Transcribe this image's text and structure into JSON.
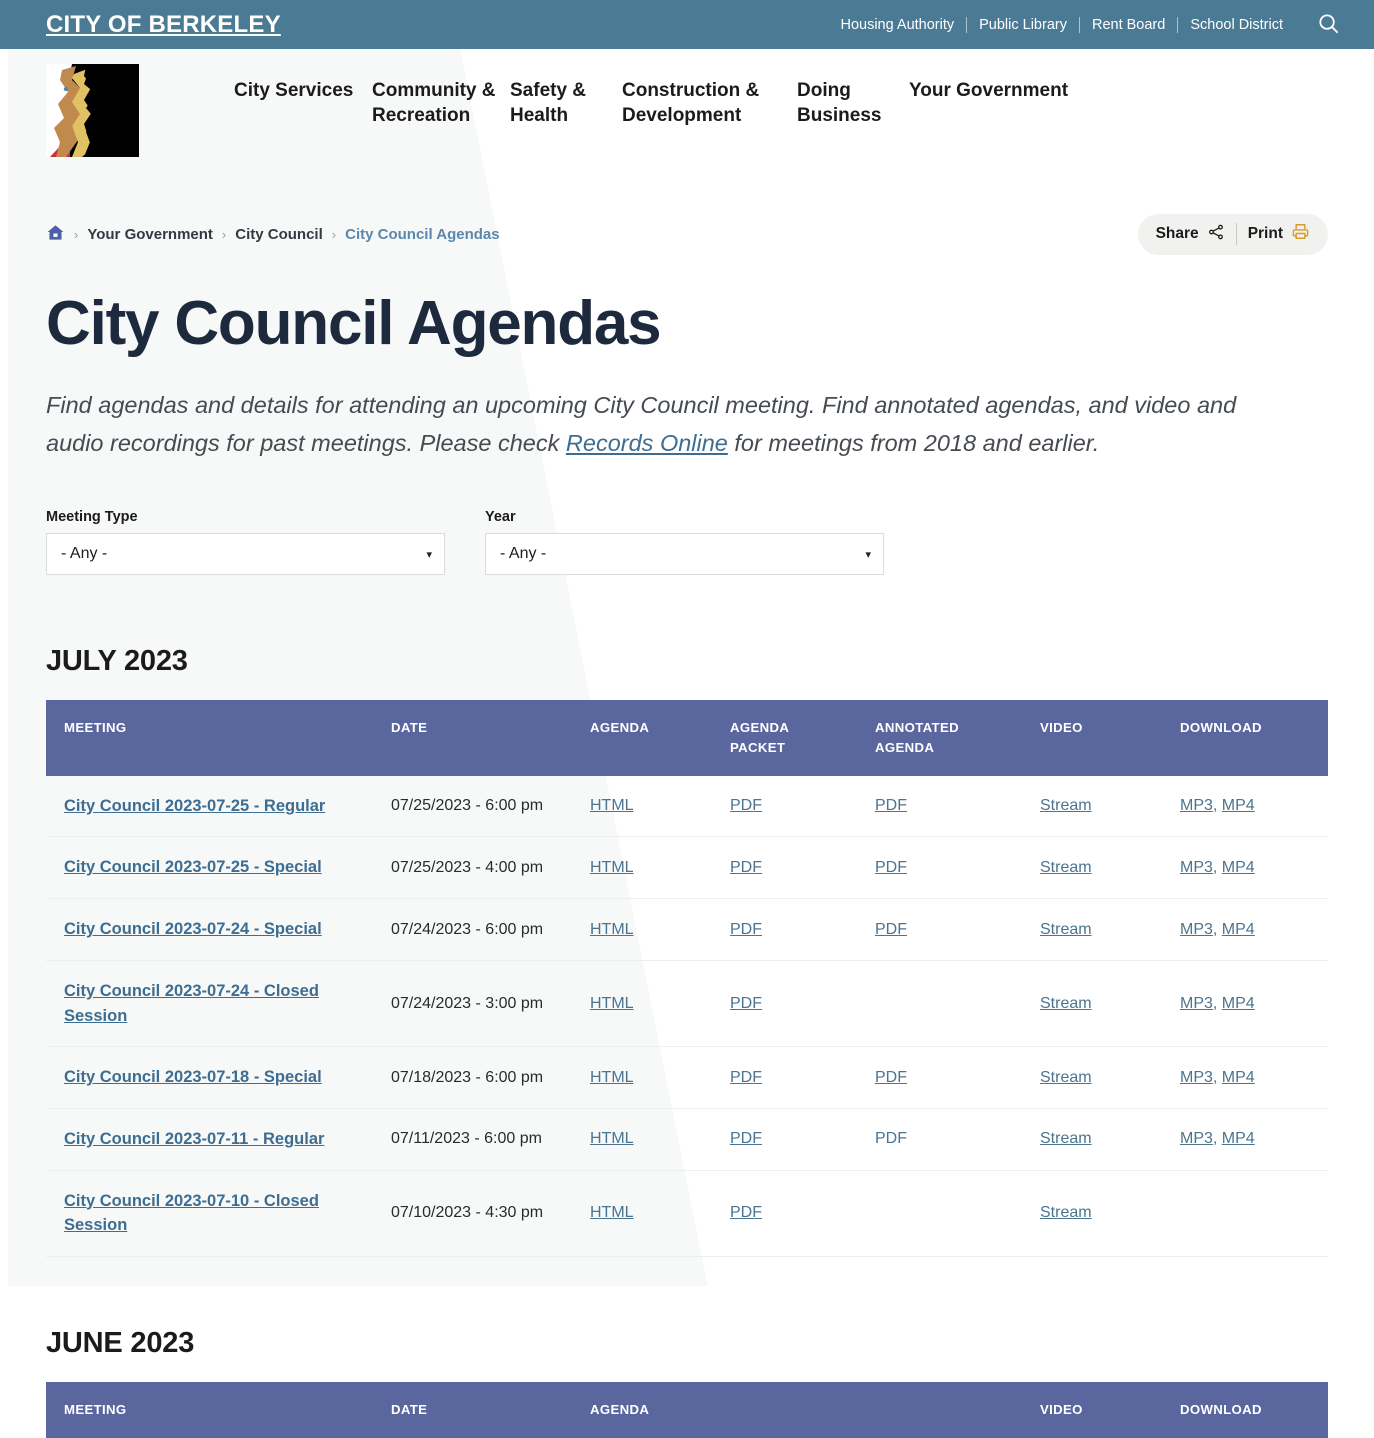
{
  "colors": {
    "utility_bar": "#4b7a94",
    "table_header": "#5a679e",
    "title": "#1d2a3d",
    "link": "#3e6d92",
    "print_icon": "#d99b2b"
  },
  "utility_bar": {
    "site_title": "CITY OF BERKELEY",
    "links": [
      "Housing Authority",
      "Public Library",
      "Rent Board",
      "School District"
    ],
    "search_icon": "search-icon"
  },
  "masthead": {
    "logo_alt": "City of Berkeley logo",
    "nav": [
      "City Services",
      "Community & Recreation",
      "Safety & Health",
      "Construction & Development",
      "Doing Business",
      "Your Government"
    ]
  },
  "breadcrumb": {
    "home_icon": "home-icon",
    "items": [
      "Your Government",
      "City Council"
    ],
    "current": "City Council Agendas",
    "separator": "›"
  },
  "actions": {
    "share_label": "Share",
    "share_icon": "share-nodes-icon",
    "print_label": "Print",
    "print_icon": "printer-icon"
  },
  "page": {
    "title": "City Council Agendas",
    "intro_part1": "Find agendas and details for attending an upcoming City Council meeting. Find annotated agendas, and video and audio recordings for past meetings. Please check ",
    "intro_link": "Records Online",
    "intro_part2": " for meetings from 2018 and earlier."
  },
  "filters": [
    {
      "label": "Meeting Type",
      "value": "- Any -",
      "caret": "▾"
    },
    {
      "label": "Year",
      "value": "- Any -",
      "caret": "▾"
    }
  ],
  "table": {
    "columns": [
      {
        "key": "meeting",
        "label": "MEETING"
      },
      {
        "key": "date",
        "label": "DATE"
      },
      {
        "key": "agenda",
        "label": "AGENDA"
      },
      {
        "key": "packet",
        "label": "AGENDA",
        "label2": "PACKET"
      },
      {
        "key": "annot",
        "label": "ANNOTATED",
        "label2": "AGENDA"
      },
      {
        "key": "video",
        "label": "VIDEO"
      },
      {
        "key": "download",
        "label": "DOWNLOAD"
      }
    ]
  },
  "sections": [
    {
      "heading": "JULY 2023",
      "rows": [
        {
          "meeting": "City Council 2023-07-25 - Regular",
          "date": "07/25/2023 - 6:00 pm",
          "agenda": "HTML",
          "packet": "PDF",
          "annot": "PDF",
          "annot_is_link": true,
          "video": "Stream",
          "download": [
            "MP3",
            "MP4"
          ]
        },
        {
          "meeting": "City Council 2023-07-25 - Special",
          "date": "07/25/2023 - 4:00 pm",
          "agenda": "HTML",
          "packet": "PDF",
          "annot": "PDF",
          "annot_is_link": true,
          "video": "Stream",
          "download": [
            "MP3",
            "MP4"
          ]
        },
        {
          "meeting": "City Council 2023-07-24 - Special",
          "date": "07/24/2023 - 6:00 pm",
          "agenda": "HTML",
          "packet": "PDF",
          "annot": "PDF",
          "annot_is_link": true,
          "video": "Stream",
          "download": [
            "MP3",
            "MP4"
          ]
        },
        {
          "meeting": "City Council 2023-07-24 - Closed Session",
          "date": "07/24/2023 - 3:00 pm",
          "agenda": "HTML",
          "packet": "PDF",
          "annot": "",
          "annot_is_link": false,
          "video": "Stream",
          "download": [
            "MP3",
            "MP4"
          ]
        },
        {
          "meeting": "City Council 2023-07-18 - Special",
          "date": "07/18/2023 - 6:00 pm",
          "agenda": "HTML",
          "packet": "PDF",
          "annot": "PDF",
          "annot_is_link": true,
          "video": "Stream",
          "download": [
            "MP3",
            "MP4"
          ]
        },
        {
          "meeting": "City Council 2023-07-11 - Regular",
          "date": "07/11/2023 - 6:00 pm",
          "agenda": "HTML",
          "packet": "PDF",
          "annot": "PDF",
          "annot_is_link": false,
          "video": "Stream",
          "download": [
            "MP3",
            "MP4"
          ]
        },
        {
          "meeting": "City Council 2023-07-10 - Closed Session",
          "date": "07/10/2023 - 4:30 pm",
          "agenda": "HTML",
          "packet": "PDF",
          "annot": "",
          "annot_is_link": false,
          "video": "Stream",
          "download": []
        }
      ]
    },
    {
      "heading": "JUNE 2023",
      "rows": []
    }
  ]
}
